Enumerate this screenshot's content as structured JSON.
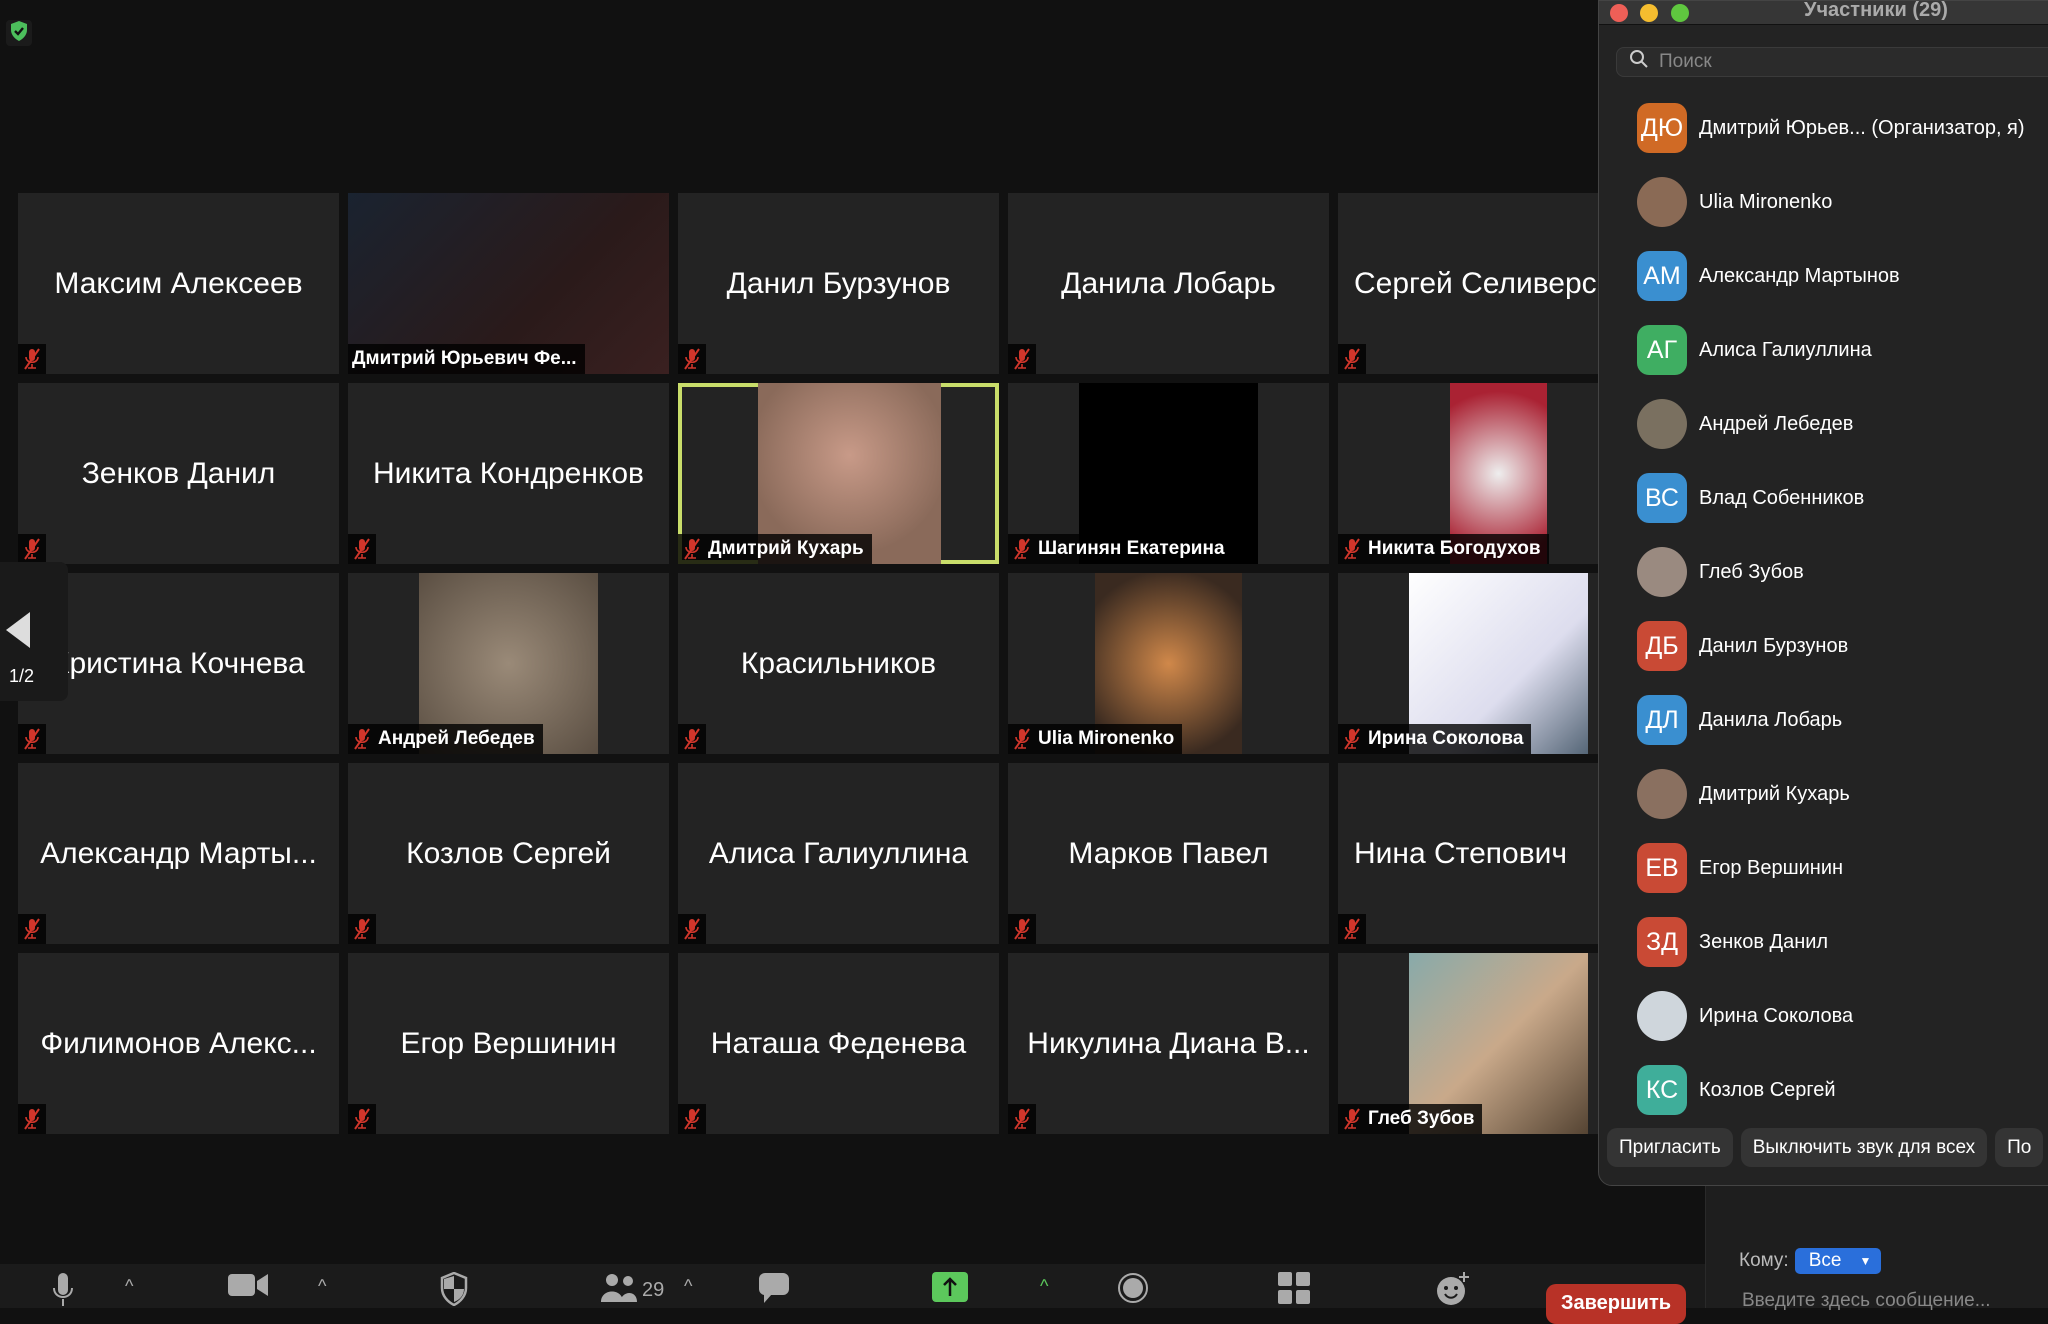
{
  "security_badge_icon": "shield-check-icon",
  "colors": {
    "accent_green": "#5cc85c",
    "active_speaker": "#c9dd6a",
    "end_red": "#b83227",
    "select_blue": "#2a6fdb",
    "mute_red": "#d0362b"
  },
  "tiles": [
    {
      "name": "Максим Алексеев",
      "video": false
    },
    {
      "name": "Дмитрий Юрьевич Фе...",
      "video": true
    },
    {
      "name": "Данил Бурзунов",
      "video": false
    },
    {
      "name": "Данила Лобарь",
      "video": false
    },
    {
      "name": "Сергей Селиверс",
      "video": false
    },
    {
      "name": "Зенков Данил",
      "video": false
    },
    {
      "name": "Никита Кондренков",
      "video": false
    },
    {
      "name": "Дмитрий Кухарь",
      "video": true,
      "active": true
    },
    {
      "name": "Шагинян Екатерина",
      "video": true
    },
    {
      "name": "Никита Богодухов",
      "video": true
    },
    {
      "name": "Кристина Кочнева",
      "video": false
    },
    {
      "name": "Андрей Лебедев",
      "video": true
    },
    {
      "name": "Красильников",
      "video": false
    },
    {
      "name": "Ulia Mironenko",
      "video": true
    },
    {
      "name": "Ирина Соколова",
      "video": true
    },
    {
      "name": "Александр Марты...",
      "video": false
    },
    {
      "name": "Козлов Сергей",
      "video": false
    },
    {
      "name": "Алиса Галиуллина",
      "video": false
    },
    {
      "name": "Марков Павел",
      "video": false
    },
    {
      "name": "Нина Степович",
      "video": false
    },
    {
      "name": "Филимонов Алекс...",
      "video": false
    },
    {
      "name": "Егор Вершинин",
      "video": false
    },
    {
      "name": "Наташа Феденева",
      "video": false
    },
    {
      "name": "Никулина Диана В...",
      "video": false
    },
    {
      "name": "Глеб Зубов",
      "video": true
    }
  ],
  "pager": {
    "label": "1/2"
  },
  "panel": {
    "title": "Участники (29)",
    "search_placeholder": "Поиск",
    "participants": [
      {
        "initials": "ДЮ",
        "name": "Дмитрий Юрьев...  (Организатор, я)",
        "color": "#d06a25"
      },
      {
        "initials": "",
        "name": "Ulia Mironenko",
        "color": "#8a6a55"
      },
      {
        "initials": "АМ",
        "name": "Александр Мартынов",
        "color": "#3a8fd0"
      },
      {
        "initials": "АГ",
        "name": "Алиса Галиуллина",
        "color": "#3fae62"
      },
      {
        "initials": "",
        "name": "Андрей Лебедев",
        "color": "#7a7060"
      },
      {
        "initials": "ВС",
        "name": "Влад Собенников",
        "color": "#3a8fd0"
      },
      {
        "initials": "",
        "name": "Глеб Зубов",
        "color": "#9a8a80"
      },
      {
        "initials": "ДБ",
        "name": "Данил Бурзунов",
        "color": "#c94a35"
      },
      {
        "initials": "ДЛ",
        "name": "Данила Лобарь",
        "color": "#3a8fd0"
      },
      {
        "initials": "",
        "name": "Дмитрий Кухарь",
        "color": "#8a7060"
      },
      {
        "initials": "ЕВ",
        "name": "Егор Вершинин",
        "color": "#c94a35"
      },
      {
        "initials": "ЗД",
        "name": "Зенков Данил",
        "color": "#c94a35"
      },
      {
        "initials": "",
        "name": "Ирина Соколова",
        "color": "#cfd6dc"
      },
      {
        "initials": "КС",
        "name": "Козлов Сергей",
        "color": "#3fae9a"
      }
    ],
    "buttons": [
      "Пригласить",
      "Выключить звук для всех",
      "По"
    ]
  },
  "chat": {
    "to_label": "Кому:",
    "to_value": "Все",
    "input_placeholder": "Введите здесь сообщение..."
  },
  "toolbar": {
    "participants_count": "29",
    "end_label": "Завершить"
  }
}
